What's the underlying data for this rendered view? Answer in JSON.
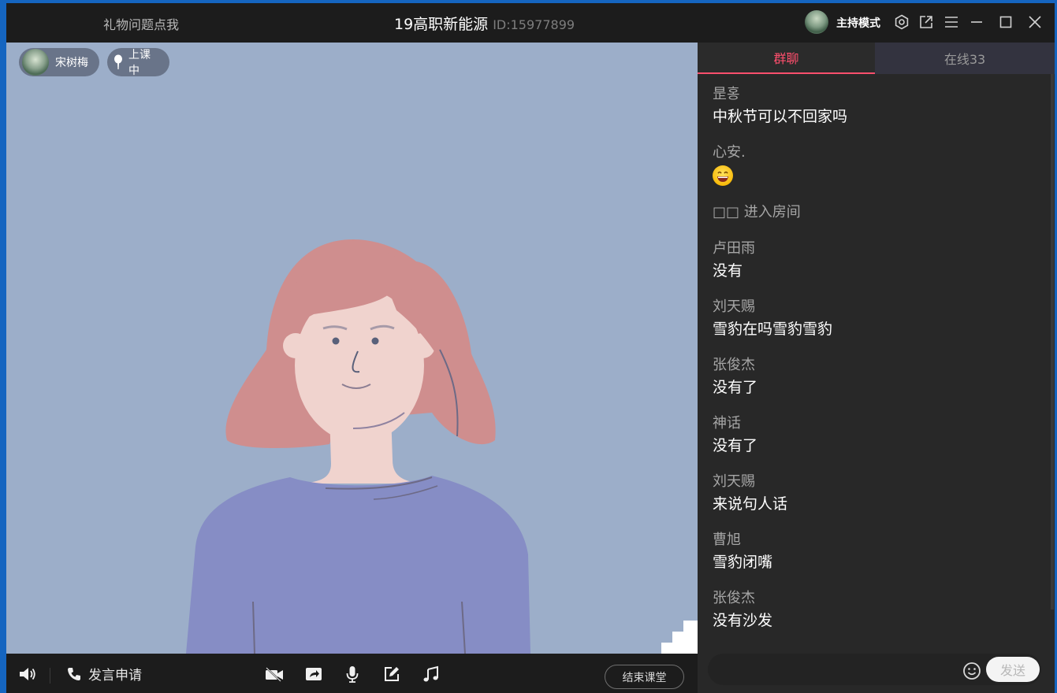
{
  "titlebar": {
    "gift_link": "礼物问题点我",
    "room_title": "19高职新能源",
    "room_id": "ID:15977899",
    "host_mode": "主持模式"
  },
  "icons": {
    "settings": "gear-icon",
    "popout": "external-link-icon",
    "menu": "menu-icon",
    "minimize": "minimize-icon",
    "maximize": "maximize-icon",
    "close": "close-icon"
  },
  "video": {
    "host_name": "宋树梅",
    "status": "上课中",
    "background_color": "#9caec9"
  },
  "bottombar": {
    "speak_apply": "发言申请",
    "end_class": "结束课堂"
  },
  "chat": {
    "tab_group": "群聊",
    "tab_online": "在线33",
    "messages": [
      {
        "name": "昰홍",
        "text": "中秋节可以不回家吗"
      },
      {
        "name": "心安.",
        "text": ""
      },
      {
        "system": "□□ 进入房间"
      },
      {
        "name": "卢田雨",
        "text": "没有"
      },
      {
        "name": "刘天赐",
        "text": "雪豹在吗雪豹雪豹"
      },
      {
        "name": "张俊杰",
        "text": "没有了"
      },
      {
        "name": "神话",
        "text": "没有了"
      },
      {
        "name": "刘天赐",
        "text": "来说句人话"
      },
      {
        "name": "曹旭",
        "text": "雪豹闭嘴"
      },
      {
        "name": "张俊杰",
        "text": "没有沙发"
      }
    ],
    "send_label": "发送",
    "accent_color": "#ff4f6d"
  }
}
